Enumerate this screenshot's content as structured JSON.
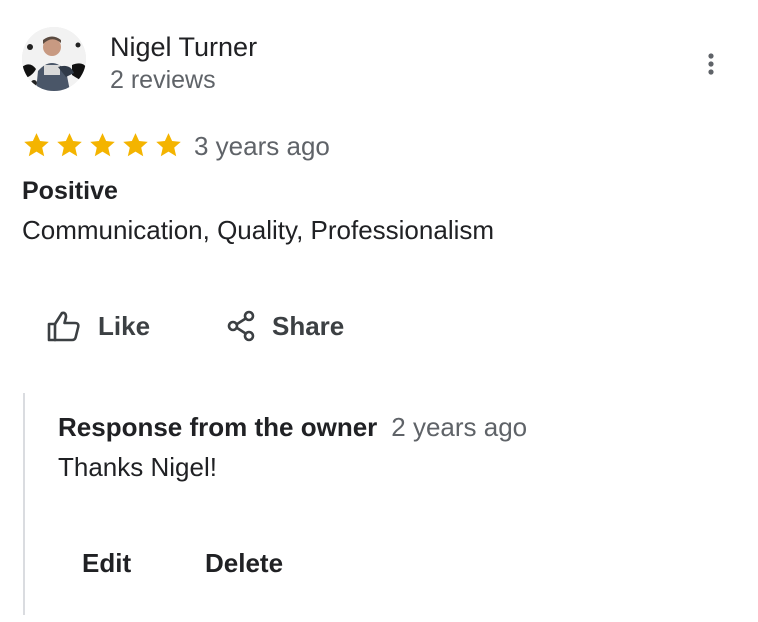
{
  "reviewer": {
    "name": "Nigel Turner",
    "meta": "2 reviews"
  },
  "review": {
    "rating": 5,
    "max_rating": 5,
    "time": "3 years ago",
    "attributes_heading": "Positive",
    "attributes_values": "Communication, Quality, Professionalism"
  },
  "actions": {
    "like_label": "Like",
    "share_label": "Share"
  },
  "owner_response": {
    "title": "Response from the owner",
    "time": "2 years ago",
    "text": "Thanks Nigel!",
    "edit_label": "Edit",
    "delete_label": "Delete"
  },
  "icons": {
    "more": "more-vert-icon",
    "like": "thumb-up-icon",
    "share": "share-icon",
    "star": "star-icon"
  },
  "colors": {
    "star": "#F4B400",
    "primary_text": "#202124",
    "secondary_text": "#5f6368",
    "divider": "#dadce0"
  }
}
